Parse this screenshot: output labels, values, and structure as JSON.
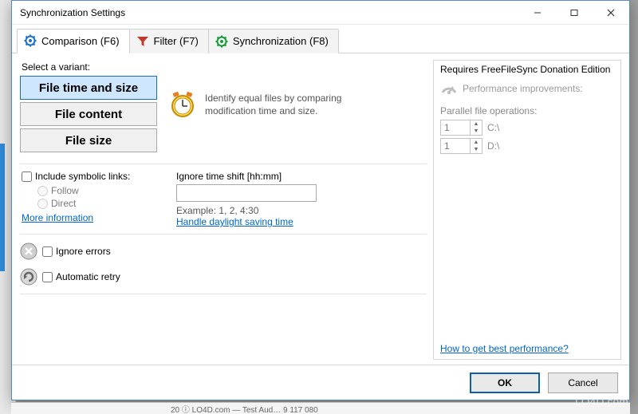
{
  "window": {
    "title": "Synchronization Settings"
  },
  "tabs": {
    "comparison": "Comparison (F6)",
    "filter": "Filter (F7)",
    "synchronization": "Synchronization (F8)"
  },
  "variant": {
    "label": "Select a variant:",
    "time_size": "File time and size",
    "content": "File content",
    "size": "File size"
  },
  "description": "Identify equal files by comparing modification time and size.",
  "symbolic": {
    "label": "Include symbolic links:",
    "follow": "Follow",
    "direct": "Direct",
    "more": "More information"
  },
  "timeshift": {
    "label": "Ignore time shift [hh:mm]",
    "value": "",
    "example": "Example: 1, 2, 4:30",
    "dst_link": "Handle daylight saving time"
  },
  "errors": {
    "ignore": "Ignore errors",
    "retry": "Automatic retry"
  },
  "right": {
    "requires": "Requires FreeFileSync Donation Edition",
    "perf": "Performance improvements:",
    "parallel_label": "Parallel file operations:",
    "rows": [
      {
        "value": "1",
        "drive": "C:\\"
      },
      {
        "value": "1",
        "drive": "D:\\"
      }
    ],
    "best_link": "How to get best performance?"
  },
  "footer": {
    "ok": "OK",
    "cancel": "Cancel"
  },
  "watermark": "LO4D.com",
  "bottom": "20  ⓘ LO4D.com — Test Aud…           9 117 080"
}
